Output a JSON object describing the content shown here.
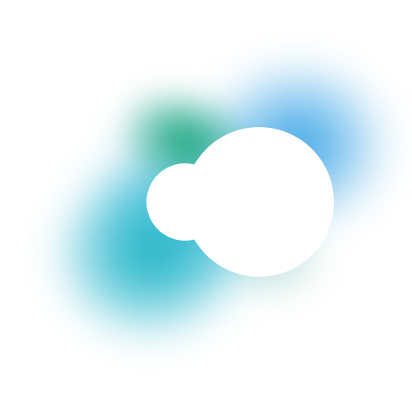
{
  "artwork": {
    "colors": {
      "teal": "#0EAEBE",
      "blue": "#1E96E1",
      "green": "#08A06E",
      "shape": "#FFFFFF",
      "background": "#FFFFFF"
    }
  }
}
